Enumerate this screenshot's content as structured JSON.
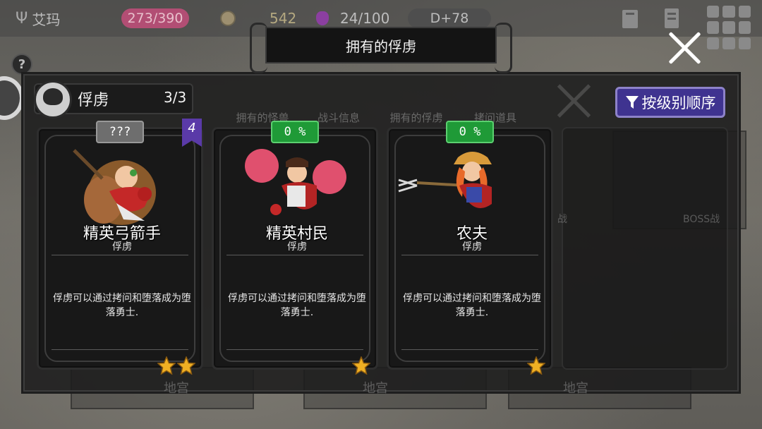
{
  "status_bar": {
    "player_name": "艾玛",
    "hp": "273/390",
    "gold": "542",
    "mana": "24/100",
    "day": "D+78"
  },
  "dialog": {
    "title": "拥有的俘虏"
  },
  "background_tabs": [
    "拥有的怪兽",
    "战斗信息",
    "拥有的俘虏",
    "拷问道具"
  ],
  "background_labels": [
    "地宫",
    "地宫",
    "地宫",
    "BOSS战",
    "战"
  ],
  "captive_panel": {
    "label": "俘虏",
    "count": "3/3",
    "sort_label": "按级别顺序"
  },
  "cards": [
    {
      "badge": "???",
      "badge_style": "gray",
      "name": "精英弓箭手",
      "type": "俘虏",
      "description": "俘虏可以通过拷问和堕落成为堕落勇士.",
      "stars": 2,
      "level_flag": "4"
    },
    {
      "badge": "0 %",
      "badge_style": "green",
      "name": "精英村民",
      "type": "俘虏",
      "description": "俘虏可以通过拷问和堕落成为堕落勇士.",
      "stars": 1
    },
    {
      "badge": "0 %",
      "badge_style": "green",
      "name": "农夫",
      "type": "俘虏",
      "description": "俘虏可以通过拷问和堕落成为堕落勇士.",
      "stars": 1
    }
  ],
  "colors": {
    "accent_purple": "#3f3390",
    "badge_green": "#1f9a37",
    "hp_pink": "#c0476e"
  }
}
